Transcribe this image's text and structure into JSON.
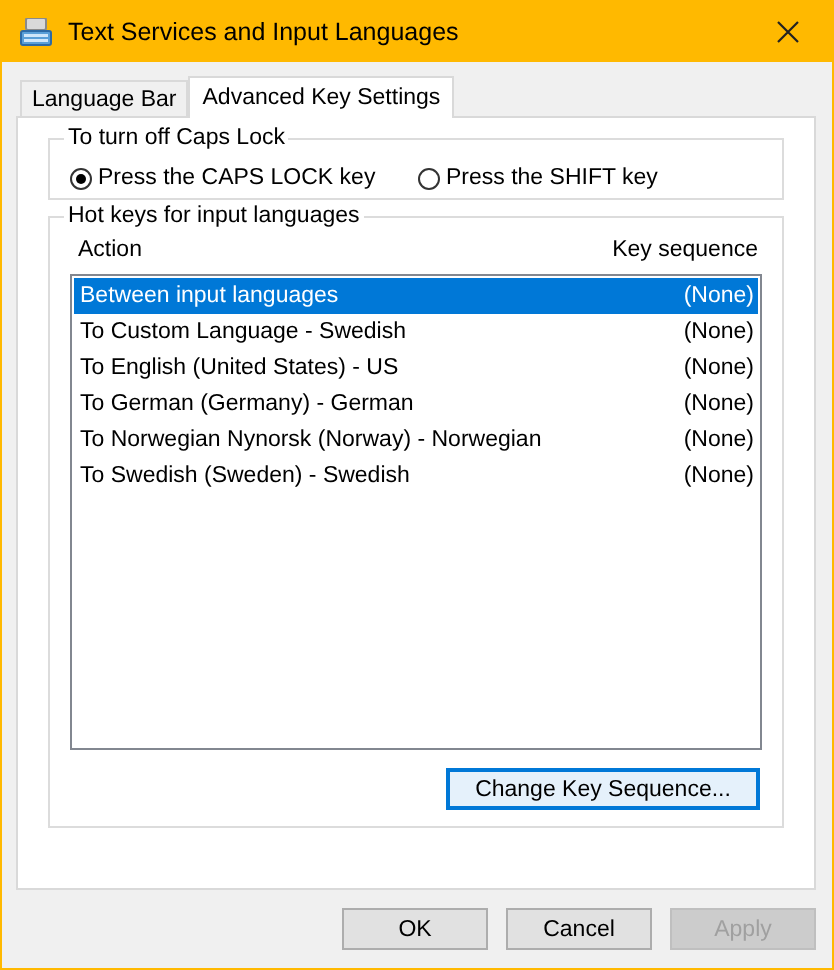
{
  "window": {
    "title": "Text Services and Input Languages"
  },
  "tabs": [
    {
      "label": "Language Bar",
      "selected": false
    },
    {
      "label": "Advanced Key Settings",
      "selected": true
    }
  ],
  "caps_lock_group": {
    "title": "To turn off Caps Lock",
    "options": [
      {
        "label": "Press the CAPS LOCK key",
        "selected": true
      },
      {
        "label": "Press the SHIFT key",
        "selected": false
      }
    ]
  },
  "hot_keys_group": {
    "title": "Hot keys for input languages",
    "columns": [
      "Action",
      "Key sequence"
    ],
    "rows": [
      {
        "action": "Between input languages",
        "key_sequence": "(None)",
        "selected": true
      },
      {
        "action": "To Custom Language - Swedish",
        "key_sequence": "(None)",
        "selected": false
      },
      {
        "action": "To English (United States) - US",
        "key_sequence": "(None)",
        "selected": false
      },
      {
        "action": "To German (Germany) - German",
        "key_sequence": "(None)",
        "selected": false
      },
      {
        "action": "To Norwegian Nynorsk (Norway) - Norwegian",
        "key_sequence": "(None)",
        "selected": false
      },
      {
        "action": "To Swedish (Sweden) - Swedish",
        "key_sequence": "(None)",
        "selected": false
      }
    ],
    "button": {
      "label": "Change Key Sequence...",
      "disabled": false
    }
  },
  "buttons": [
    {
      "label": "OK",
      "disabled": false
    },
    {
      "label": "Cancel",
      "disabled": false
    },
    {
      "label": "Apply",
      "disabled": true
    }
  ]
}
